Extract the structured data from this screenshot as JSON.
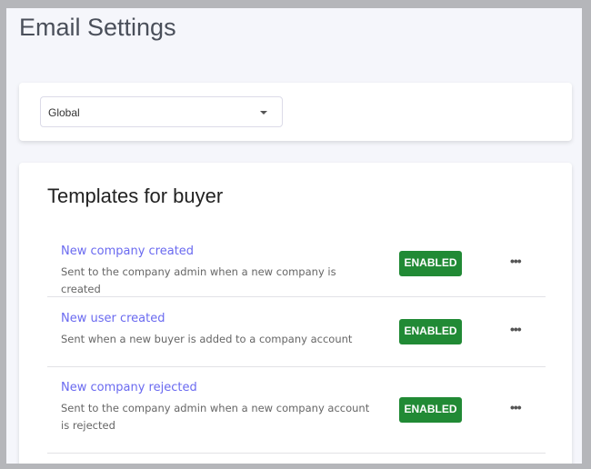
{
  "page": {
    "title": "Email Settings"
  },
  "scope_select": {
    "value": "Global"
  },
  "templates": {
    "heading": "Templates for buyer",
    "items": [
      {
        "name": "New company created",
        "description": "Sent to the company admin when a new company is created",
        "status": "ENABLED"
      },
      {
        "name": "New user created",
        "description": "Sent when a new buyer is added to a company account",
        "status": "ENABLED"
      },
      {
        "name": "New company rejected",
        "description": "Sent to the company admin when a new company account is rejected",
        "status": "ENABLED"
      }
    ]
  },
  "colors": {
    "enabled": "#218a35",
    "link": "#6a6af0"
  }
}
